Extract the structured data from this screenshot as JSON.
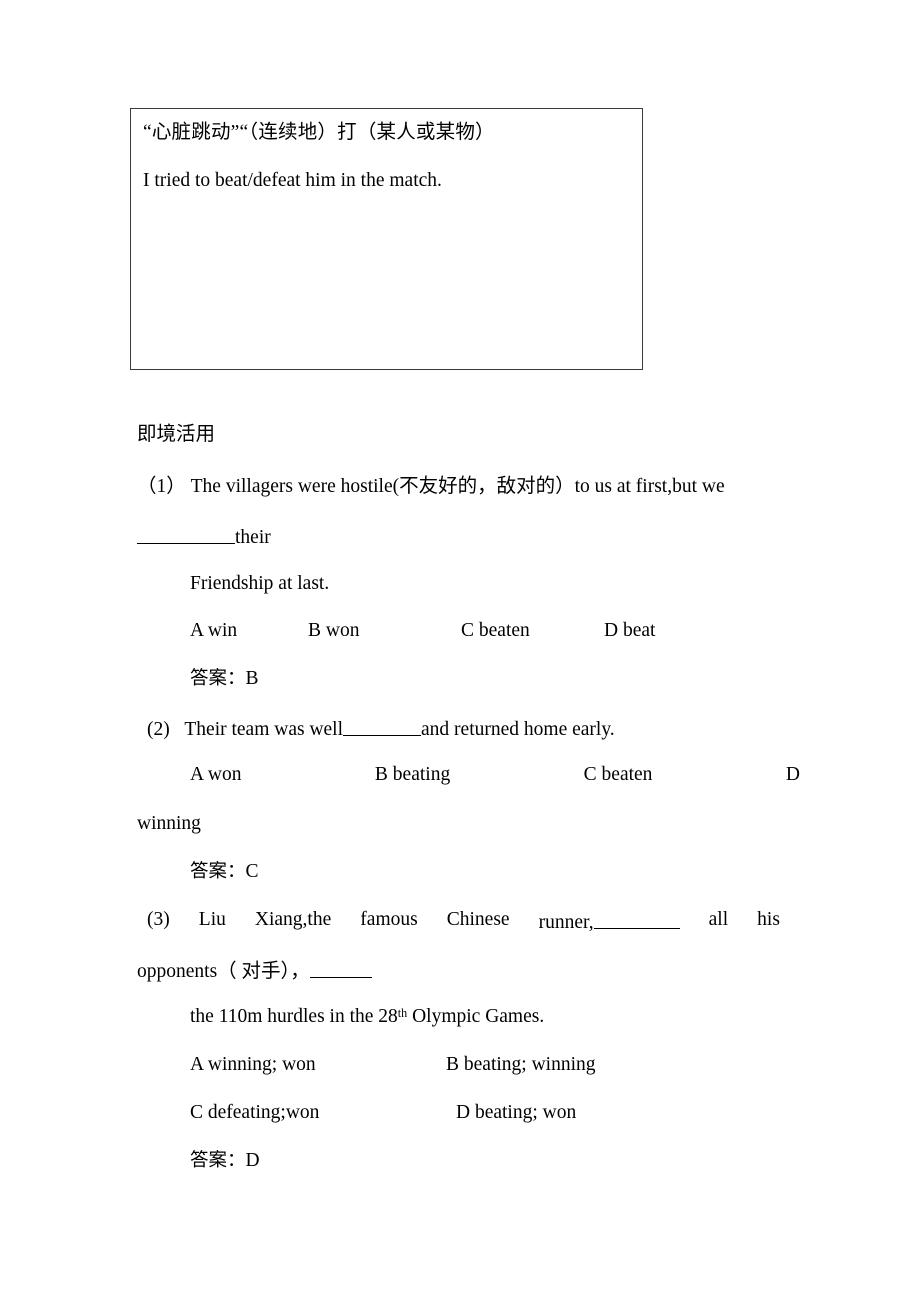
{
  "document": {
    "definition_box": {
      "line_cn": "“心脏跳动”“（连续地）打（某人或某物）",
      "line_en": "I tried to beat/defeat him in the match."
    },
    "section_heading": "即境活用",
    "questions": [
      {
        "number": "（1）",
        "stem_line1": "The villagers were hostile(不友好的，敌对的）to us at first,but we",
        "stem_line2_after_blank": "their",
        "stem_line3": "Friendship at last.",
        "options": [
          "A win",
          "B won",
          "C beaten",
          "D beat"
        ],
        "answer_label": "答案：",
        "answer_value": "B"
      },
      {
        "number": "(2)",
        "stem_before_blank": "Their team was well",
        "stem_after_blank": "and returned home early.",
        "options_row": [
          "A   won",
          "B   beating",
          "C  beaten",
          "D"
        ],
        "options_wrap": "winning",
        "answer_label": "答案：",
        "answer_value": "C"
      },
      {
        "number": "(3)",
        "stem_words": [
          "Liu",
          "Xiang,the",
          "famous",
          "Chinese",
          "runner,",
          "all",
          "his"
        ],
        "stem_line2_prefix": "opponents（ 对手），",
        "stem_line3_pre": "the 110m hurdles in the 28",
        "stem_line3_ord": "th",
        "stem_line3_post": " Olympic Games.",
        "options": [
          "A winning; won",
          "B beating; winning",
          "C defeating;won",
          "D beating; won"
        ],
        "answer_label": "答案：",
        "answer_value": "D"
      }
    ]
  },
  "colors": {
    "page_background": "#ffffff",
    "text": "#000000",
    "box_border": "#3a3a3a"
  }
}
